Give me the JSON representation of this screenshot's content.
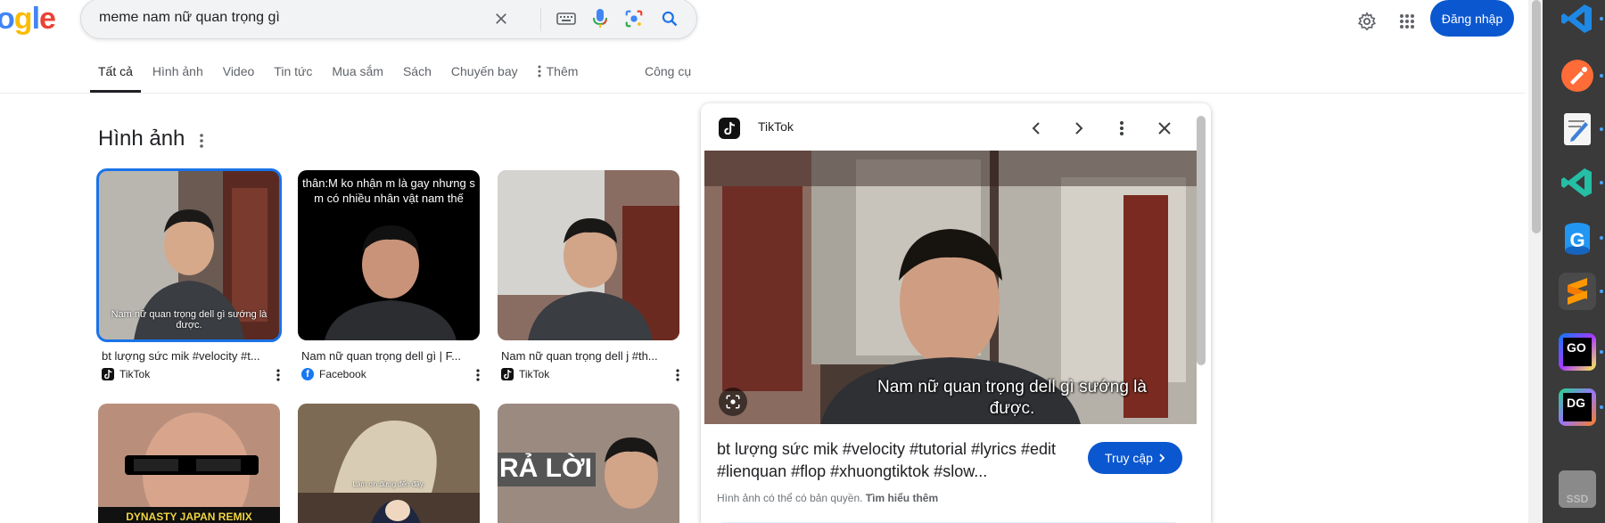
{
  "search": {
    "query": "meme nam nữ quan trọng gì",
    "login_label": "Đăng nhập"
  },
  "tabs": [
    {
      "label": "Tất cả"
    },
    {
      "label": "Hình ảnh"
    },
    {
      "label": "Video"
    },
    {
      "label": "Tin tức"
    },
    {
      "label": "Mua sắm"
    },
    {
      "label": "Sách"
    },
    {
      "label": "Chuyến bay"
    },
    {
      "label": "Thêm"
    }
  ],
  "tools_label": "Công cụ",
  "images_section": {
    "title": "Hình ảnh",
    "results": [
      {
        "caption": "bt lượng sức mik #velocity #t...",
        "source": "TikTok",
        "overlay": "Nam nữ quan trọng dell gì sướng là được."
      },
      {
        "caption": "Nam nữ quan trọng dell gì | F...",
        "source": "Facebook",
        "overlay_top": "thân:M ko nhận m là gay nhưng s m có nhiều nhân vật nam thế"
      },
      {
        "caption": "Nam nữ quan trọng dell j #th...",
        "source": "TikTok"
      }
    ],
    "row2": [
      {
        "overlay": "DYNASTY JAPAN REMIX"
      },
      {
        "overlay": "Làm ơn đừng đến đây."
      },
      {
        "overlay": "RẢ LỜI"
      }
    ]
  },
  "preview": {
    "source": "TikTok",
    "subtitle": "Nam nữ quan trọng dell gì sướng là được.",
    "title": "bt lượng sức mik #velocity #tutorial #lyrics #edit #lienquan #flop #xhuongtiktok #slow...",
    "visit_label": "Truy cập",
    "copyright": "Hình ảnh có thể có bản quyền.",
    "learn_more": "Tìm hiểu thêm"
  },
  "dock": [
    {
      "name": "vscode-blue"
    },
    {
      "name": "postman"
    },
    {
      "name": "text-editor"
    },
    {
      "name": "vscode-insiders"
    },
    {
      "name": "gitkraken"
    },
    {
      "name": "sublime-text"
    },
    {
      "name": "goland",
      "label": "GO"
    },
    {
      "name": "datagrip",
      "label": "DG"
    },
    {
      "name": "ssd-drive",
      "label": "SSD"
    }
  ],
  "colors": {
    "accent": "#0b57d0",
    "selected_outline": "#1a73e8"
  }
}
